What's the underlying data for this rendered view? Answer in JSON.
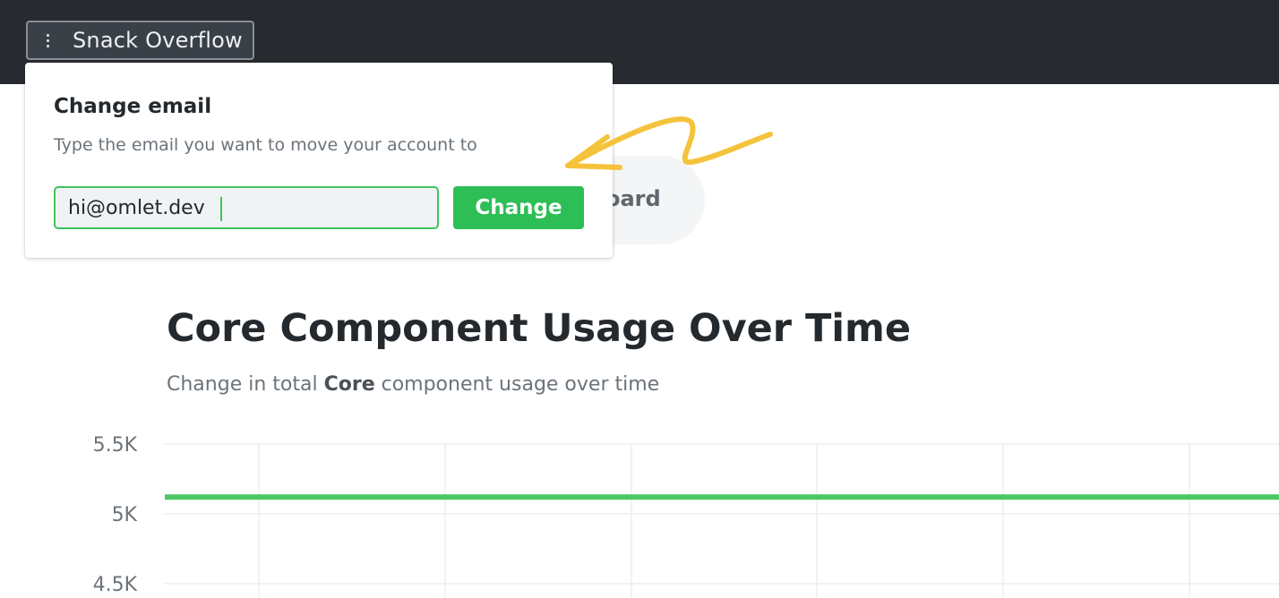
{
  "topbar": {
    "menu_icon": "vertical-dots-icon",
    "org_name": "Snack Overflow"
  },
  "popover": {
    "title": "Change email",
    "description": "Type the email you want to move your account to",
    "email_value": "hi@omlet.dev",
    "change_label": "Change"
  },
  "background_tab": {
    "visible_label": "oard"
  },
  "annotation": {
    "arrow_color": "#f5c33b"
  },
  "chart": {
    "title": "Core Component Usage Over Time",
    "subtitle_prefix": "Change in total ",
    "subtitle_bold": "Core",
    "subtitle_suffix": " component usage over time"
  },
  "colors": {
    "topbar": "#272b30",
    "accent_green": "#2dbe55",
    "series_green": "#4cc764"
  },
  "chart_data": {
    "type": "line",
    "title": "Core Component Usage Over Time",
    "subtitle": "Change in total Core component usage over time",
    "ylim": [
      4250,
      5500
    ],
    "y_ticks": [
      5500,
      5000,
      4500
    ],
    "y_tick_labels": [
      "5.5K",
      "5K",
      "4.5K"
    ],
    "grid": true,
    "series": [
      {
        "color": "#4cc764",
        "values": [
          5120,
          5120,
          5120,
          5120,
          5120,
          5120,
          5120
        ]
      }
    ]
  }
}
